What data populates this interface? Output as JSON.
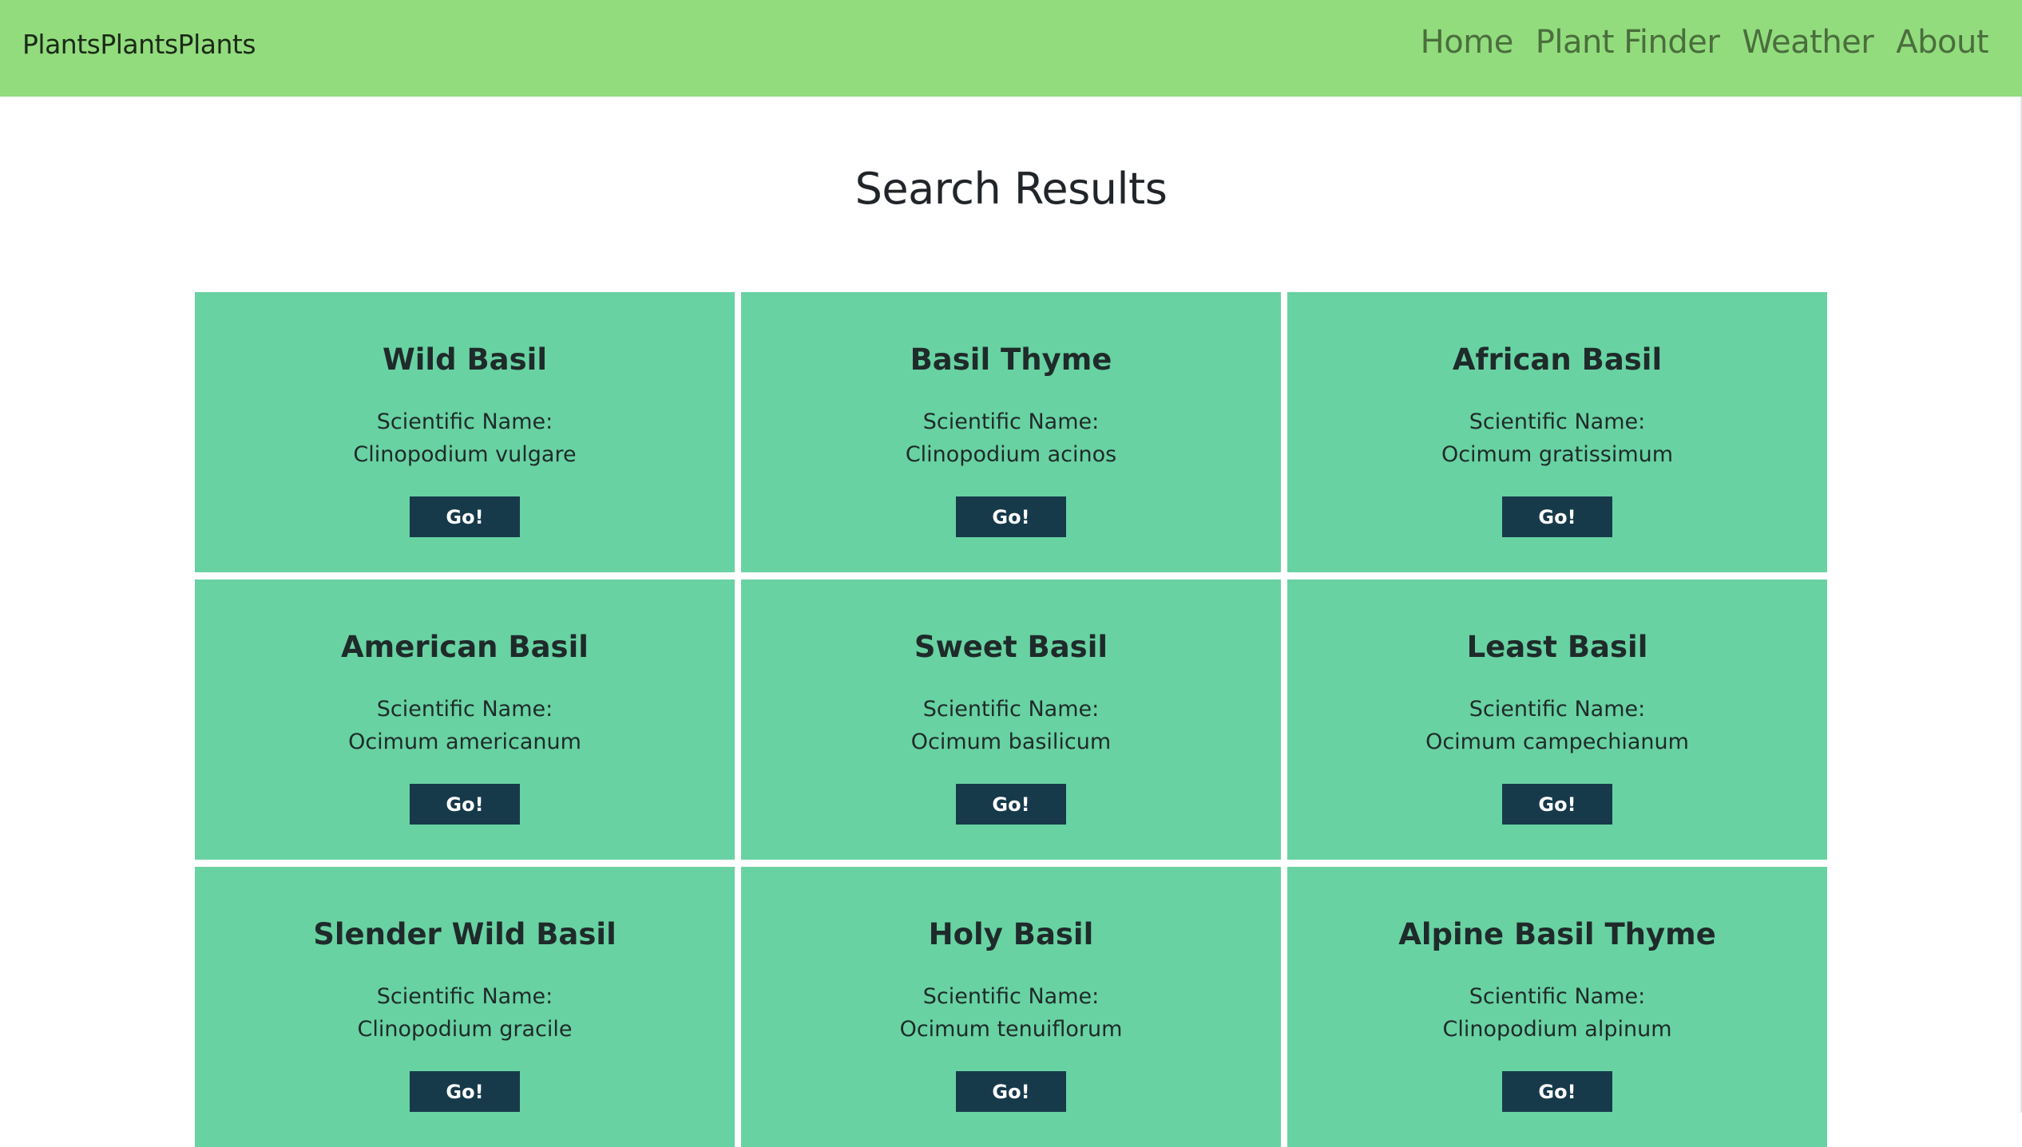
{
  "navbar": {
    "brand": "PlantsPlantsPlants",
    "links": [
      {
        "label": "Home"
      },
      {
        "label": "Plant Finder"
      },
      {
        "label": "Weather"
      },
      {
        "label": "About"
      }
    ]
  },
  "page": {
    "title": "Search Results"
  },
  "results": [
    {
      "common_name": "Wild Basil",
      "scientific_label": "Scientific Name:",
      "scientific_name": "Clinopodium vulgare",
      "button": "Go!"
    },
    {
      "common_name": "Basil Thyme",
      "scientific_label": "Scientific Name:",
      "scientific_name": "Clinopodium acinos",
      "button": "Go!"
    },
    {
      "common_name": "African Basil",
      "scientific_label": "Scientific Name:",
      "scientific_name": "Ocimum gratissimum",
      "button": "Go!"
    },
    {
      "common_name": "American Basil",
      "scientific_label": "Scientific Name:",
      "scientific_name": "Ocimum americanum",
      "button": "Go!"
    },
    {
      "common_name": "Sweet Basil",
      "scientific_label": "Scientific Name:",
      "scientific_name": "Ocimum basilicum",
      "button": "Go!"
    },
    {
      "common_name": "Least Basil",
      "scientific_label": "Scientific Name:",
      "scientific_name": "Ocimum campechianum",
      "button": "Go!"
    },
    {
      "common_name": "Slender Wild Basil",
      "scientific_label": "Scientific Name:",
      "scientific_name": "Clinopodium gracile",
      "button": "Go!"
    },
    {
      "common_name": "Holy Basil",
      "scientific_label": "Scientific Name:",
      "scientific_name": "Ocimum tenuiflorum",
      "button": "Go!"
    },
    {
      "common_name": "Alpine Basil Thyme",
      "scientific_label": "Scientific Name:",
      "scientific_name": "Clinopodium alpinum",
      "button": "Go!"
    }
  ],
  "colors": {
    "navbar_bg": "#92dc7e",
    "nav_link": "#4a6e3c",
    "card_bg": "#68d2a2",
    "button_bg": "#173a4b",
    "button_text": "#ffffff",
    "text": "#212529"
  }
}
